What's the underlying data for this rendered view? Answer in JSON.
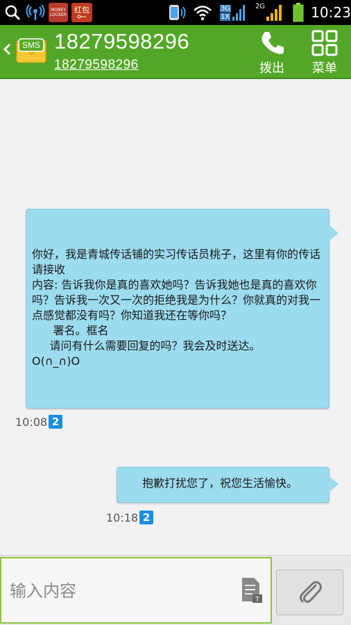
{
  "status_bar": {
    "time": "10:23",
    "money_locker_text": "MONEY LOCKER",
    "hongbao_text": "红包",
    "net_3g": "3G",
    "net_1x": "1X",
    "net_2g": "2G",
    "icons": [
      "search-icon",
      "wifi-hotspot-icon",
      "money-locker-icon",
      "hongbao-icon",
      "volume-icon",
      "wifi-icon",
      "signal-3g-icon",
      "signal-2g-icon",
      "battery-icon"
    ]
  },
  "header": {
    "contact_name": "18279598296",
    "contact_number": "18279598296",
    "sms_icon_text": "SMS",
    "call_label": "拨出",
    "menu_label": "菜单"
  },
  "messages": [
    {
      "direction": "incoming",
      "text": "你好，我是青城传话铺的实习传话员桃子，这里有你的传话请接收\n内容: 告诉我你是真的喜欢她吗？告诉我她也是真的喜欢你吗？告诉我一次又一次的拒绝我是为什么？你就真的对我一点感觉都没有吗？你知道我还在等你吗？\n      署名。框名\n     请问有什么需要回复的吗？我会及时送达。\nO(∩_∩)O",
      "time": "10:08",
      "sim": "2"
    },
    {
      "direction": "outgoing",
      "text": "抱歉打扰您了，祝您生活愉快。",
      "time": "10:18",
      "sim": "2"
    }
  ],
  "input": {
    "placeholder": "输入内容",
    "value": ""
  },
  "colors": {
    "header_green": "#53a726",
    "bubble_blue": "#9cdcef",
    "sim_badge_blue": "#1a8fe0",
    "input_border_green": "#8cc63f"
  }
}
